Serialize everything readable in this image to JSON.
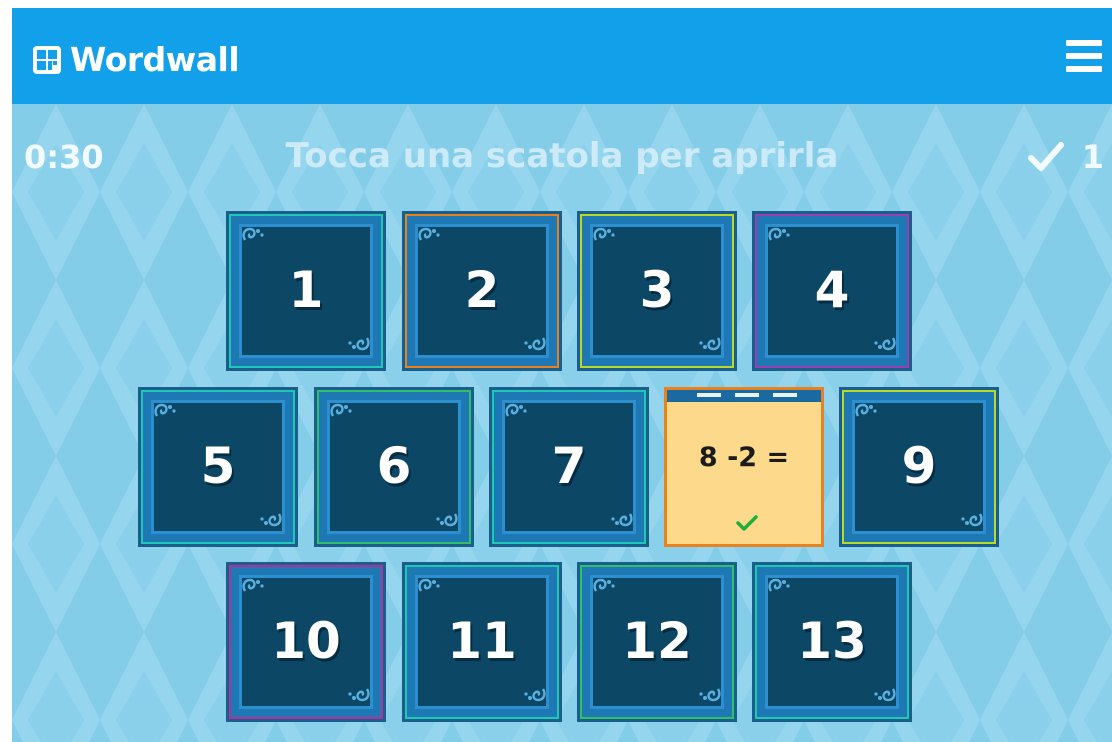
{
  "header": {
    "brand": "Wordwall",
    "brand_color": "#13a0ea",
    "logo_icon": "wordwall-logo-icon",
    "menu_icon": "hamburger-menu-icon"
  },
  "game": {
    "timer": "0:30",
    "instruction": "Tocca una scatola per aprirla",
    "score": "1",
    "score_icon": "checkmark-icon",
    "background_color": "#84cde9",
    "boxes": [
      {
        "label": "1",
        "accent": "#1fc7b6"
      },
      {
        "label": "2",
        "accent": "#e8821e"
      },
      {
        "label": "3",
        "accent": "#b8d82a"
      },
      {
        "label": "4",
        "accent": "#9a3eb4"
      },
      {
        "label": "5",
        "accent": "#1fc7b6"
      },
      {
        "label": "6",
        "accent": "#30c06c"
      },
      {
        "label": "7",
        "accent": "#1fc7b6"
      },
      {
        "label": "8 -2 =",
        "accent": "#e8821e",
        "opened": true,
        "result_icon": "green-check-icon"
      },
      {
        "label": "9",
        "accent": "#b8d82a"
      },
      {
        "label": "10",
        "accent": "#b0309e"
      },
      {
        "label": "11",
        "accent": "#1fc7b6"
      },
      {
        "label": "12",
        "accent": "#30c06c"
      },
      {
        "label": "13",
        "accent": "#1fc7b6"
      }
    ]
  }
}
